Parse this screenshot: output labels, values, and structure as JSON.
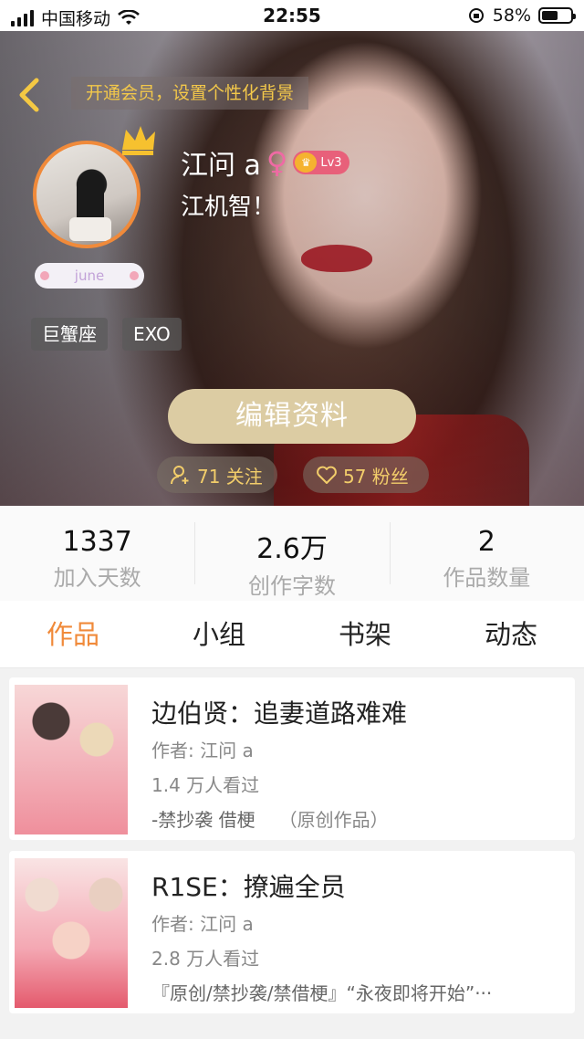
{
  "status_bar": {
    "carrier": "中国移动",
    "time": "22:55",
    "battery": "58%",
    "battery_level": 0.58
  },
  "profile": {
    "vip_banner": "开通会员，设置个性化背景",
    "name": "江问 a",
    "gender_symbol": "♀",
    "level": "Lv3",
    "signature": "江机智！",
    "nickname_tag": "june",
    "tags": [
      "巨蟹座",
      "EXO"
    ],
    "edit_button": "编辑资料",
    "follow_label": "71 关注",
    "fans_label": "57 粉丝",
    "accent_color": "#f08a3a"
  },
  "stats": [
    {
      "value": "1337",
      "label": "加入天数"
    },
    {
      "value": "2.6万",
      "label": "创作字数"
    },
    {
      "value": "2",
      "label": "作品数量"
    }
  ],
  "tabs": [
    {
      "label": "作品",
      "active": true
    },
    {
      "label": "小组",
      "active": false
    },
    {
      "label": "书架",
      "active": false
    },
    {
      "label": "动态",
      "active": false
    }
  ],
  "works": [
    {
      "title": "边伯贤：追妻道路难难",
      "author": "作者: 江问 a",
      "views": "1.4 万人看过",
      "tags": "-禁抄袭 借梗",
      "original": "（原创作品）"
    },
    {
      "title": "R1SE：撩遍全员",
      "author": "作者: 江问 a",
      "views": "2.8 万人看过",
      "tags": "『原创/禁抄袭/禁借梗』“永夜即将开始”···",
      "original": ""
    }
  ]
}
